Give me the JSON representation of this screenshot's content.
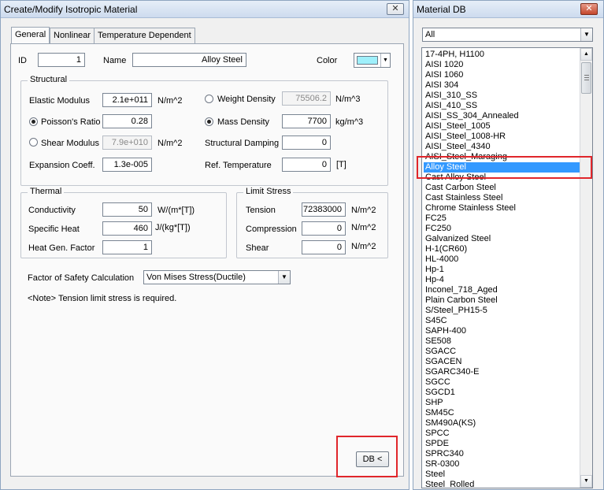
{
  "left_window": {
    "title": "Create/Modify Isotropic Material",
    "close_label": "✕",
    "tabs": [
      {
        "label": "General"
      },
      {
        "label": "Nonlinear"
      },
      {
        "label": "Temperature Dependent"
      }
    ],
    "id": {
      "label": "ID",
      "value": "1"
    },
    "name": {
      "label": "Name",
      "value": "Alloy Steel"
    },
    "color": {
      "label": "Color",
      "swatch": "#9ff0fb"
    },
    "structural": {
      "title": "Structural",
      "elastic_modulus": {
        "label": "Elastic Modulus",
        "value": "2.1e+011",
        "unit": "N/m^2"
      },
      "poissons_ratio": {
        "label": "Poisson's Ratio",
        "value": "0.28"
      },
      "shear_modulus": {
        "label": "Shear Modulus",
        "value": "7.9e+010",
        "unit": "N/m^2"
      },
      "expansion_coeff": {
        "label": "Expansion Coeff.",
        "value": "1.3e-005"
      },
      "weight_density": {
        "label": "Weight Density",
        "value": "75506.2",
        "unit": "N/m^3"
      },
      "mass_density": {
        "label": "Mass Density",
        "value": "7700",
        "unit": "kg/m^3"
      },
      "structural_damping": {
        "label": "Structural Damping",
        "value": "0"
      },
      "ref_temperature": {
        "label": "Ref. Temperature",
        "value": "0",
        "unit": "[T]"
      }
    },
    "thermal": {
      "title": "Thermal",
      "conductivity": {
        "label": "Conductivity",
        "value": "50",
        "unit": "W/(m*[T])"
      },
      "specific_heat": {
        "label": "Specific Heat",
        "value": "460",
        "unit": "J/(kg*[T])"
      },
      "heat_gen_factor": {
        "label": "Heat Gen. Factor",
        "value": "1"
      }
    },
    "limit_stress": {
      "title": "Limit Stress",
      "tension": {
        "label": "Tension",
        "value": "72383000",
        "unit": "N/m^2"
      },
      "compression": {
        "label": "Compression",
        "value": "0",
        "unit": "N/m^2"
      },
      "shear": {
        "label": "Shear",
        "value": "0",
        "unit": "N/m^2"
      }
    },
    "safety": {
      "label": "Factor of Safety Calculation",
      "value": "Von Mises Stress(Ductile)"
    },
    "note": "<Note> Tension limit stress is required.",
    "db_button": "DB <"
  },
  "right_window": {
    "title": "Material DB",
    "close_label": "✕",
    "filter": "All",
    "materials": [
      "17-4PH, H1100",
      "AISI 1020",
      "AISI 1060",
      "AISI 304",
      "AISI_310_SS",
      "AISI_410_SS",
      "AISI_SS_304_Annealed",
      "AISI_Steel_1005",
      "AISI_Steel_1008-HR",
      "AISI_Steel_4340",
      "AISI_Steel_Maraging",
      "Alloy Steel",
      "Cast Alloy Steel",
      "Cast Carbon Steel",
      "Cast Stainless Steel",
      "Chrome Stainless Steel",
      "FC25",
      "FC250",
      "Galvanized Steel",
      "H-1(CR60)",
      "HL-4000",
      "Hp-1",
      "Hp-4",
      "Inconel_718_Aged",
      "Plain Carbon Steel",
      "S/Steel_PH15-5",
      "S45C",
      "SAPH-400",
      "SE508",
      "SGACC",
      "SGACEN",
      "SGARC340-E",
      "SGCC",
      "SGCD1",
      "SHP",
      "SM45C",
      "SM490A(KS)",
      "SPCC",
      "SPDE",
      "SPRC340",
      "SR-0300",
      "Steel",
      "Steel_Rolled"
    ],
    "selected_index": 11
  }
}
